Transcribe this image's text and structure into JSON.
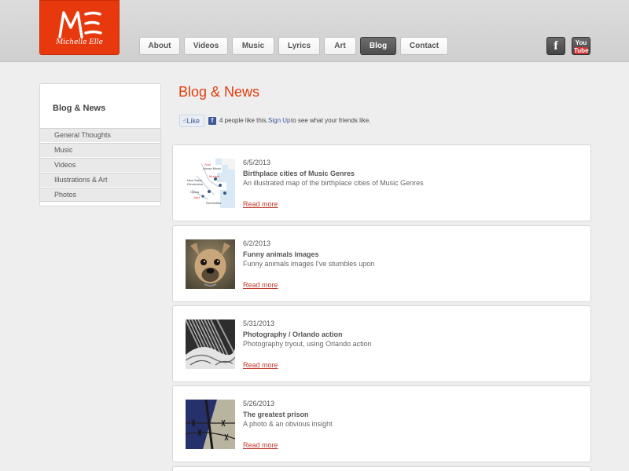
{
  "logo": {
    "monogram": "ME",
    "name": "Michelle Elle"
  },
  "nav": {
    "items": [
      {
        "label": "About"
      },
      {
        "label": "Videos"
      },
      {
        "label": "Music"
      },
      {
        "label": "Lyrics"
      },
      {
        "label": "Art"
      },
      {
        "label": "Blog",
        "active": true
      },
      {
        "label": "Contact"
      }
    ]
  },
  "social": {
    "facebook": "f",
    "youtube_top": "You",
    "youtube_bottom": "Tube"
  },
  "sidebar": {
    "title": "Blog & News",
    "items": [
      {
        "label": "General Thoughts"
      },
      {
        "label": "Music"
      },
      {
        "label": "Videos"
      },
      {
        "label": "Illustrations & Art"
      },
      {
        "label": "Photos"
      }
    ]
  },
  "main": {
    "title": "Blog & News"
  },
  "like": {
    "button": "Like",
    "count_text": "4 people like this.",
    "signup": "Sign Up",
    "rest": "to see what your friends like."
  },
  "posts": [
    {
      "date": "6/5/2013",
      "title": "Birthplace cities of Music Genres",
      "desc": "An illustrated map of the birthplace cities of Music Genres",
      "read_more": "Read more",
      "thumb": "map-thumbnail",
      "thumb_labels": [
        "Soul",
        "House Music",
        "Munich",
        "New Wave",
        "Electronica",
        "Opera",
        "Jazz",
        "Rembetika"
      ]
    },
    {
      "date": "6/2/2013",
      "title": "Funny animals images",
      "desc": "Funny animals images I've stumbles upon",
      "read_more": "Read more",
      "thumb": "dog-thumbnail"
    },
    {
      "date": "5/31/2013",
      "title": "Photography / Orlando action",
      "desc": "Photography tryout, using Orlando action",
      "read_more": "Read more",
      "thumb": "abstract-photo-thumbnail"
    },
    {
      "date": "5/26/2013",
      "title": "The greatest prison",
      "desc": "A photo & an obvious insight",
      "read_more": "Read more",
      "thumb": "barbed-wire-thumbnail"
    }
  ],
  "colors": {
    "accent": "#e0400d",
    "logo_bg": "#e8380d",
    "nav_active": "#555555",
    "link": "#c0392b",
    "fb_blue": "#3b5998"
  }
}
